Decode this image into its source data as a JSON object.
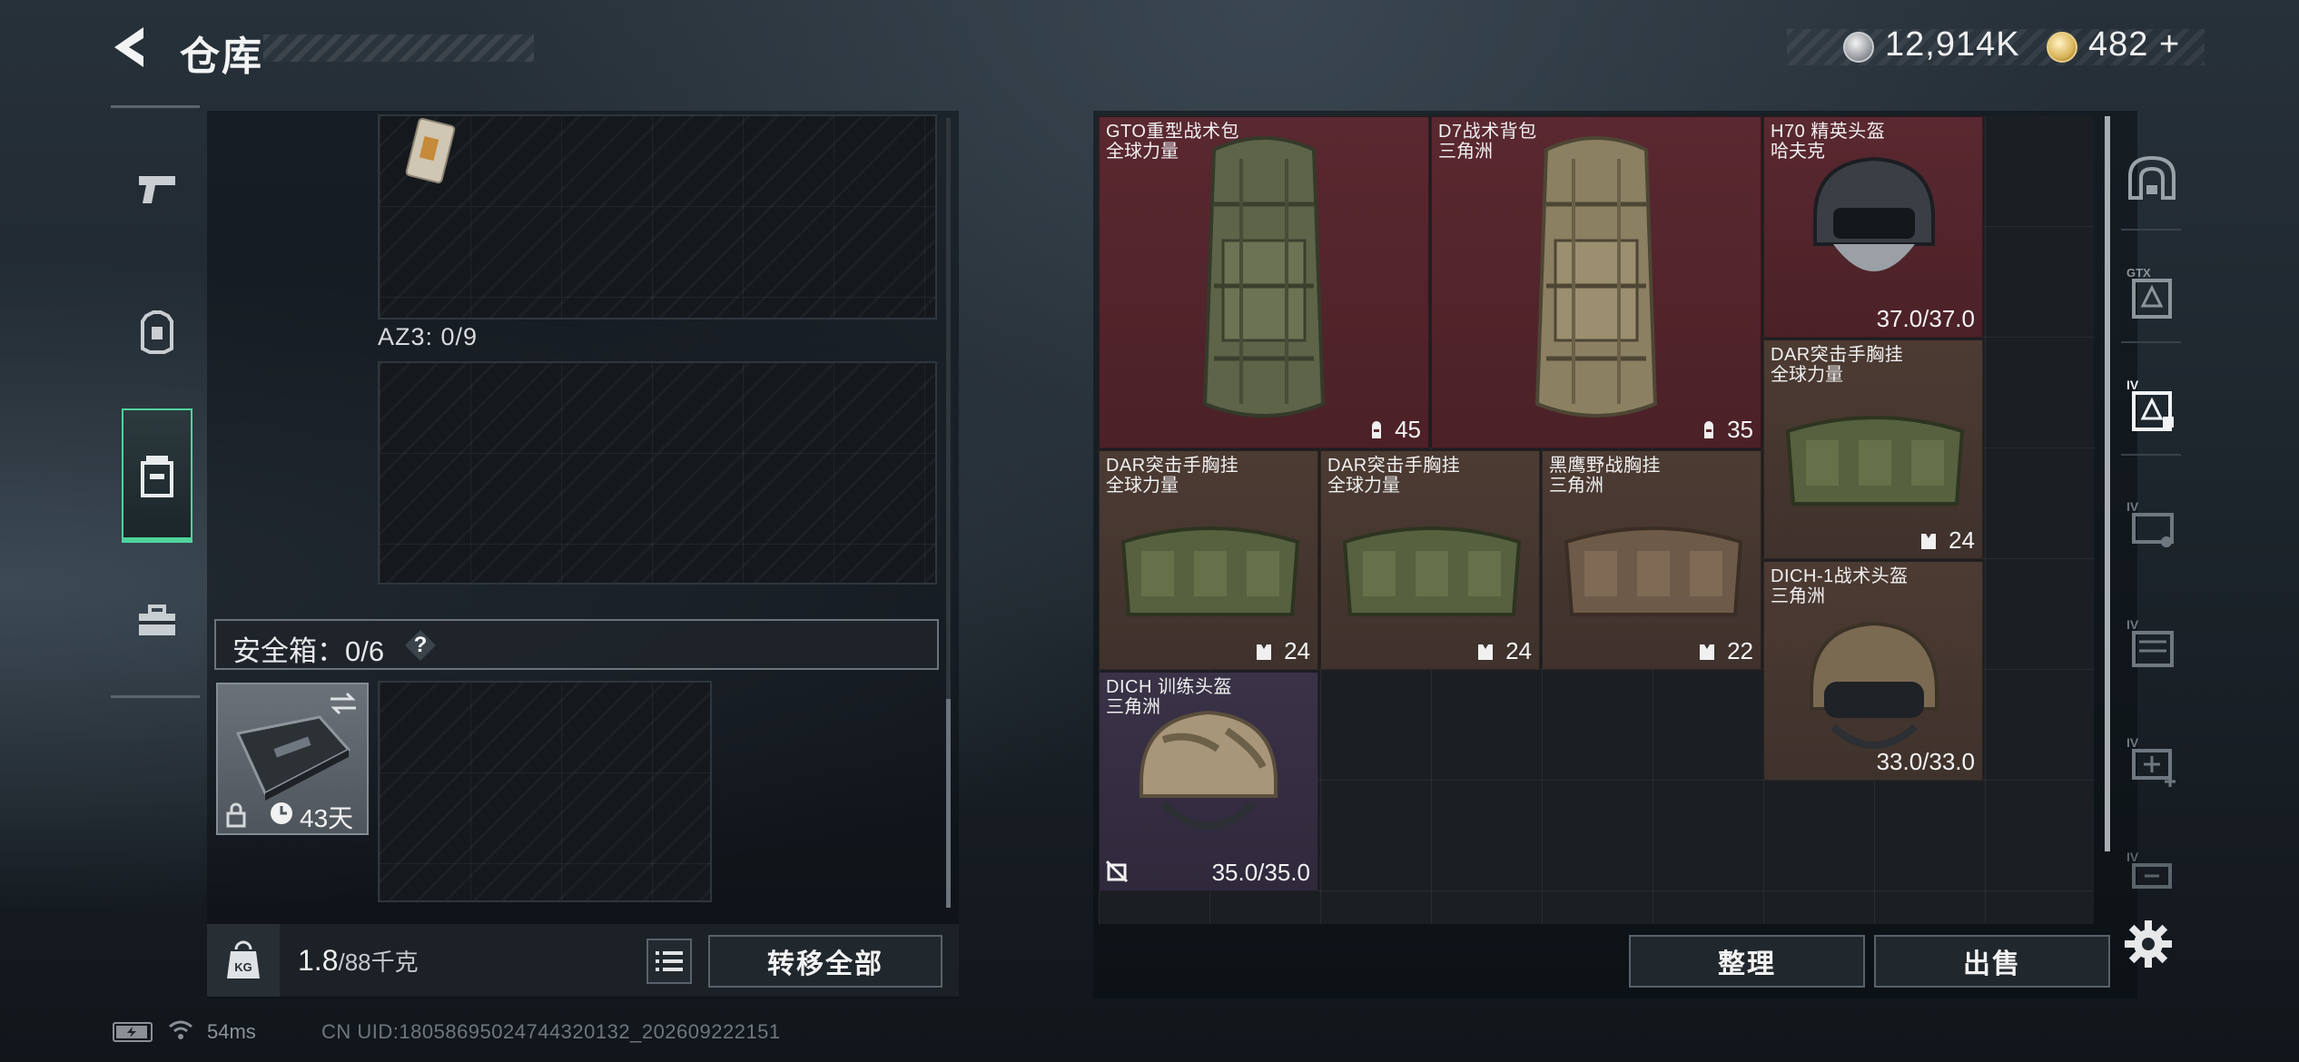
{
  "header": {
    "title": "仓库",
    "currencies": [
      {
        "icon": "silver-coin-icon",
        "value": "12,914K"
      },
      {
        "icon": "gold-coin-icon",
        "value": "482",
        "add_symbol": "+"
      }
    ]
  },
  "left_categories": [
    {
      "icon": "pistol-icon",
      "active": false
    },
    {
      "icon": "helmet-armor-icon",
      "active": false
    },
    {
      "icon": "backpack-icon",
      "active": true
    },
    {
      "icon": "toolbox-icon",
      "active": false
    }
  ],
  "left_panel": {
    "container_label": "AZ3: 0/9",
    "safe_box_label": "安全箱：0/6",
    "help_symbol": "?",
    "safe_box_item": {
      "days": "43天"
    },
    "weight": {
      "current": "1.8",
      "max": "/88千克"
    },
    "transfer_all_label": "转移全部"
  },
  "stash_items": [
    {
      "name": "GTO重型战术包",
      "sub": "全球力量",
      "value": "45",
      "value_icon": "backpack-capacity-icon",
      "bg": "red"
    },
    {
      "name": "D7战术背包",
      "sub": "三角洲",
      "value": "35",
      "value_icon": "backpack-capacity-icon",
      "bg": "red"
    },
    {
      "name": "H70 精英头盔",
      "sub": "哈夫克",
      "value": "37.0/37.0",
      "value_icon": "",
      "bg": "red"
    },
    {
      "name": "DAR突击手胸挂",
      "sub": "全球力量",
      "value": "24",
      "value_icon": "vest-capacity-icon",
      "bg": "brown"
    },
    {
      "name": "DAR突击手胸挂",
      "sub": "全球力量",
      "value": "24",
      "value_icon": "vest-capacity-icon",
      "bg": "brown"
    },
    {
      "name": "DAR突击手胸挂",
      "sub": "全球力量",
      "value": "24",
      "value_icon": "vest-capacity-icon",
      "bg": "brown"
    },
    {
      "name": "黑鹰野战胸挂",
      "sub": "三角洲",
      "value": "22",
      "value_icon": "vest-capacity-icon",
      "bg": "brown"
    },
    {
      "name": "DICH-1战术头盔",
      "sub": "三角洲",
      "value": "33.0/33.0",
      "value_icon": "",
      "bg": "brown"
    },
    {
      "name": "DICH 训练头盔",
      "sub": "三角洲",
      "value": "35.0/35.0",
      "value_icon": "no-insure-icon",
      "bg": "purple"
    }
  ],
  "right_categories": [
    {
      "icon": "stash-arch-icon"
    },
    {
      "icon": "stash-tab-gtx-icon"
    },
    {
      "icon": "stash-tab-iv-active-icon"
    },
    {
      "icon": "stash-tab-iv-2-icon"
    },
    {
      "icon": "stash-tab-iv-3-icon"
    },
    {
      "icon": "stash-tab-iv-add-icon"
    },
    {
      "icon": "stash-tab-iv-4-icon"
    }
  ],
  "actions": {
    "sort_label": "整理",
    "sell_label": "出售"
  },
  "status": {
    "ping": "54ms",
    "uid": "CN UID:18058695024744320132_202609222151"
  },
  "colors": {
    "active_green": "#4fd39b",
    "rarity_red": "#5a2830",
    "rarity_brown": "#4c3b33",
    "rarity_purple": "#3a3247"
  }
}
